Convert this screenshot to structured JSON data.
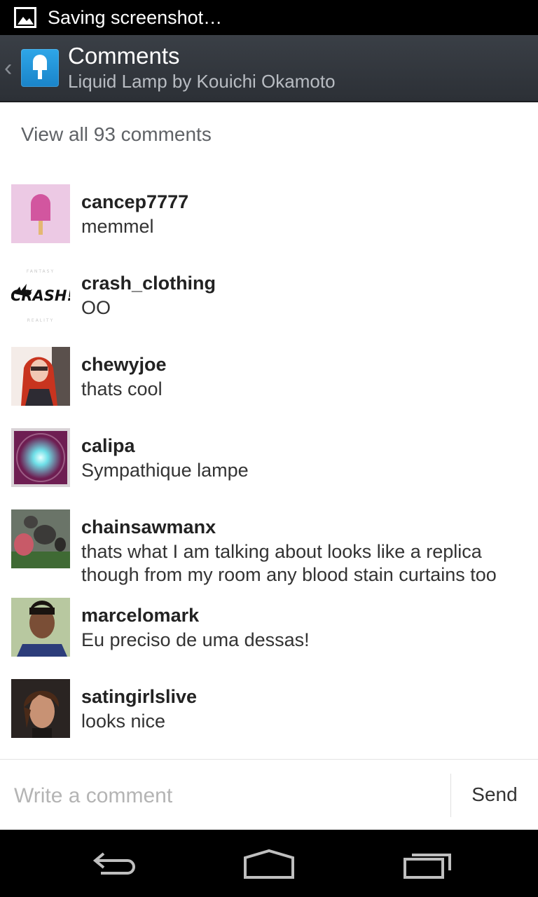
{
  "status_bar": {
    "text": "Saving screenshot…",
    "icon": "image-icon"
  },
  "action_bar": {
    "title": "Comments",
    "subtitle": "Liquid Lamp by Kouichi Okamoto",
    "icon": "popsicle-app-icon"
  },
  "view_all": "View all 93 comments",
  "comments": [
    {
      "username": "cancep7777",
      "text": "memmel"
    },
    {
      "username": "crash_clothing",
      "text": "OO",
      "avatar_text": "CRASH!"
    },
    {
      "username": "chewyjoe",
      "text": "thats cool"
    },
    {
      "username": "calipa",
      "text": "Sympathique lampe"
    },
    {
      "username": "chainsawmanx",
      "text": "thats what I am talking about looks like a replica though from my room any blood stain curtains too"
    },
    {
      "username": "marcelomark",
      "text": "Eu preciso de uma dessas!"
    },
    {
      "username": "satingirlslive",
      "text": "looks nice"
    }
  ],
  "composer": {
    "placeholder": "Write a comment",
    "send_label": "Send"
  },
  "nav_bar": {
    "icons": [
      "back-icon",
      "home-icon",
      "recent-apps-icon"
    ]
  }
}
